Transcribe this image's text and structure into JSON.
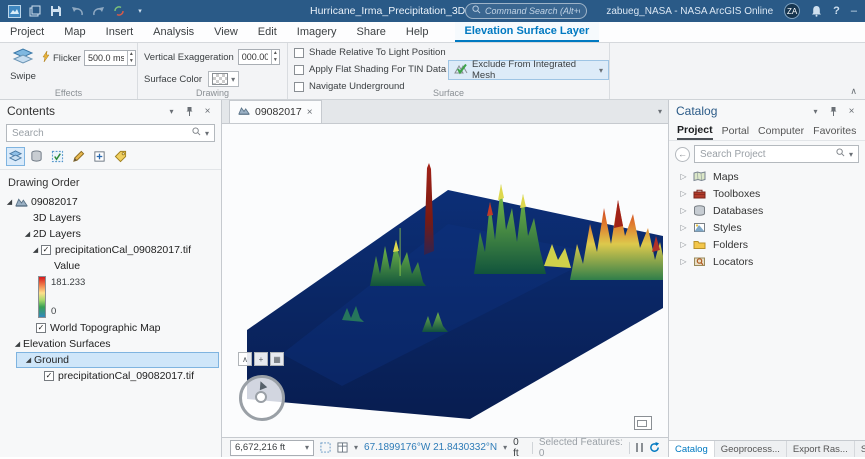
{
  "colors": {
    "accent": "#0079c1",
    "titlebar": "#2a5a87",
    "plane_blue": "#0a2a70",
    "selection_highlight": "#cfe6f9"
  },
  "titlebar": {
    "project_name": "Hurricane_Irma_Precipitation_3D",
    "command_search_placeholder": "Command Search (Alt+Q)",
    "account_label": "zabueg_NASA - NASA ArcGIS Online",
    "avatar_initials": "ZA"
  },
  "ribbon": {
    "tabs": [
      {
        "label": "Project"
      },
      {
        "label": "Map"
      },
      {
        "label": "Insert"
      },
      {
        "label": "Analysis"
      },
      {
        "label": "View"
      },
      {
        "label": "Edit"
      },
      {
        "label": "Imagery"
      },
      {
        "label": "Share"
      },
      {
        "label": "Help"
      }
    ],
    "contextual_tab": "Elevation Surface Layer",
    "effects": {
      "group_label": "Effects",
      "swipe_label": "Swipe",
      "flicker_label": "Flicker",
      "flicker_value": "500.0 ms"
    },
    "drawing": {
      "group_label": "Drawing",
      "vertical_exaggeration_label": "Vertical Exaggeration",
      "vertical_exaggeration_value": "000.00",
      "surface_color_label": "Surface Color"
    },
    "surface": {
      "group_label": "Surface",
      "shade_label": "Shade Relative To Light Position",
      "flat_shading_label": "Apply Flat Shading For TIN Data",
      "navigate_label": "Navigate Underground",
      "exclude_mesh_label": "Exclude From Integrated Mesh"
    }
  },
  "contents_pane": {
    "title": "Contents",
    "search_placeholder": "Search",
    "drawing_order_label": "Drawing Order",
    "scene_name": "09082017",
    "groups": {
      "layers3d": "3D Layers",
      "layers2d": "2D Layers",
      "elevation_surfaces": "Elevation Surfaces",
      "ground": "Ground"
    },
    "layers": {
      "precip_2d": "precipitationCal_09082017.tif",
      "value_label": "Value",
      "legend_max": "181.233",
      "legend_min": "0",
      "basemap": "World Topographic Map",
      "precip_elev": "precipitationCal_09082017.tif"
    }
  },
  "view": {
    "tab_label": "09082017",
    "statusbar": {
      "scale_value": "6,672,216 ft",
      "coordinates": "67.1899176°W 21.8430332°N",
      "elevation": "0 ft",
      "selection_status": "Selected Features: 0"
    }
  },
  "catalog_pane": {
    "title": "Catalog",
    "tabs": [
      {
        "label": "Project"
      },
      {
        "label": "Portal"
      },
      {
        "label": "Computer"
      },
      {
        "label": "Favorites"
      }
    ],
    "search_placeholder": "Search Project",
    "items": [
      {
        "label": "Maps"
      },
      {
        "label": "Toolboxes"
      },
      {
        "label": "Databases"
      },
      {
        "label": "Styles"
      },
      {
        "label": "Folders"
      },
      {
        "label": "Locators"
      }
    ],
    "bottom_tabs": [
      {
        "label": "Catalog"
      },
      {
        "label": "Geoprocess..."
      },
      {
        "label": "Export Ras..."
      },
      {
        "label": "Symbolo..."
      }
    ]
  }
}
